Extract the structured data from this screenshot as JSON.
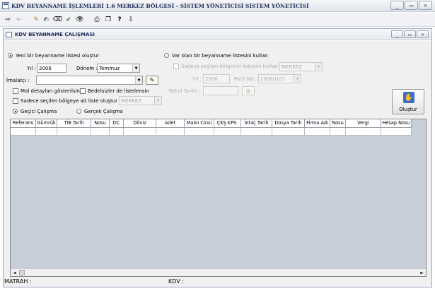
{
  "app": {
    "title": "KDV BEYANNAME İŞLEMLERİ 1.6 MERKEZ BÖLGESİ - SİSTEM YÖNETİCİSİ SİSTEM YÖNETİCİSİ",
    "window_buttons": [
      "_",
      "▭",
      "×"
    ]
  },
  "toolbar": {
    "icons": [
      "exit-icon",
      "disabled-icon",
      "pen-icon",
      "edit-icon",
      "eraser-icon",
      "check-icon",
      "binoculars-icon",
      "print-icon",
      "window-icon",
      "help-icon",
      "door-icon"
    ],
    "glyphs": [
      "⇨",
      "⇤",
      "✎",
      "✍",
      "⌫",
      "✔",
      "👁",
      "⎙",
      "❐",
      "?",
      "⇩"
    ]
  },
  "form": {
    "title": "KDV BEYANNAME ÇALIŞMASI",
    "window_buttons": [
      "_",
      "▭",
      "×"
    ],
    "radio_new": "Yeni bir beyanname listesi oluştur",
    "year_label": "Yıl :",
    "year_value": "2006",
    "period_label": "Dönem :",
    "period_value": "Temmuz",
    "maker_label": "İmalatçı :",
    "maker_value": "",
    "checkbox_mal": "Mal detayları gösterilsin",
    "checkbox_bedelsiz": "Bedelsizler de listelensin",
    "checkbox_region": "Sadece seçilen bölgeye ait liste oluştur",
    "region_value": "MERKEZ",
    "radio_gecici": "Geçici Çalışma",
    "radio_gercek": "Gerçek Çalışma",
    "radio_existing": "Var olan bir beyanname listesini kullan",
    "existing_region_check": "Sadece seçilen bölgenin listesini kullan",
    "existing_region_value": "MERKEZ",
    "existing_year_label": "Yıl :",
    "existing_year_value": "2006",
    "existing_parti_label": "Parti No :",
    "existing_parti_value": "20060101",
    "tahsil_label": "Tahsil Tarihi :",
    "tahsil_value": "",
    "create_button": "Oluştur"
  },
  "grid": {
    "columns": [
      "Referans",
      "Gümrük",
      "TİB Tarih",
      "Nosu",
      "DC",
      "Döviz",
      "Adet",
      "Malın Cinsi",
      "ÇKŞ.KPS.",
      "İntaç Tarih",
      "Dosya Tarih",
      "Firma Adı",
      "Nosu",
      "Vergi",
      "Hesap Nosu"
    ]
  },
  "footer": {
    "matrah_label": "MATRAH :",
    "matrah_value": "",
    "kdv_label": "KDV :",
    "kdv_value": ""
  }
}
